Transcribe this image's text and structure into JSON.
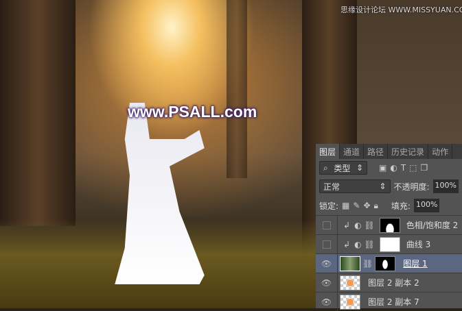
{
  "watermark": {
    "main": "www.PSALL.com",
    "site": "思缘设计论坛 WWW.MISSYUAN.COM"
  },
  "panel": {
    "tabs": [
      "图层",
      "通道",
      "路径",
      "历史记录",
      "动作"
    ],
    "filter": {
      "label": "类型"
    },
    "blend_mode": "正常",
    "opacity_label": "不透明度:",
    "opacity": "100%",
    "lock_label": "锁定:",
    "fill_label": "填充:",
    "fill": "100%",
    "layers": [
      {
        "name": "色相/饱和度 2",
        "visible": false
      },
      {
        "name": "曲线 3",
        "visible": false
      },
      {
        "name": "图层 1",
        "visible": true,
        "selected": true
      },
      {
        "name": "图层 2 副本 2",
        "visible": true
      },
      {
        "name": "图层 2 副本 7",
        "visible": true
      }
    ]
  }
}
